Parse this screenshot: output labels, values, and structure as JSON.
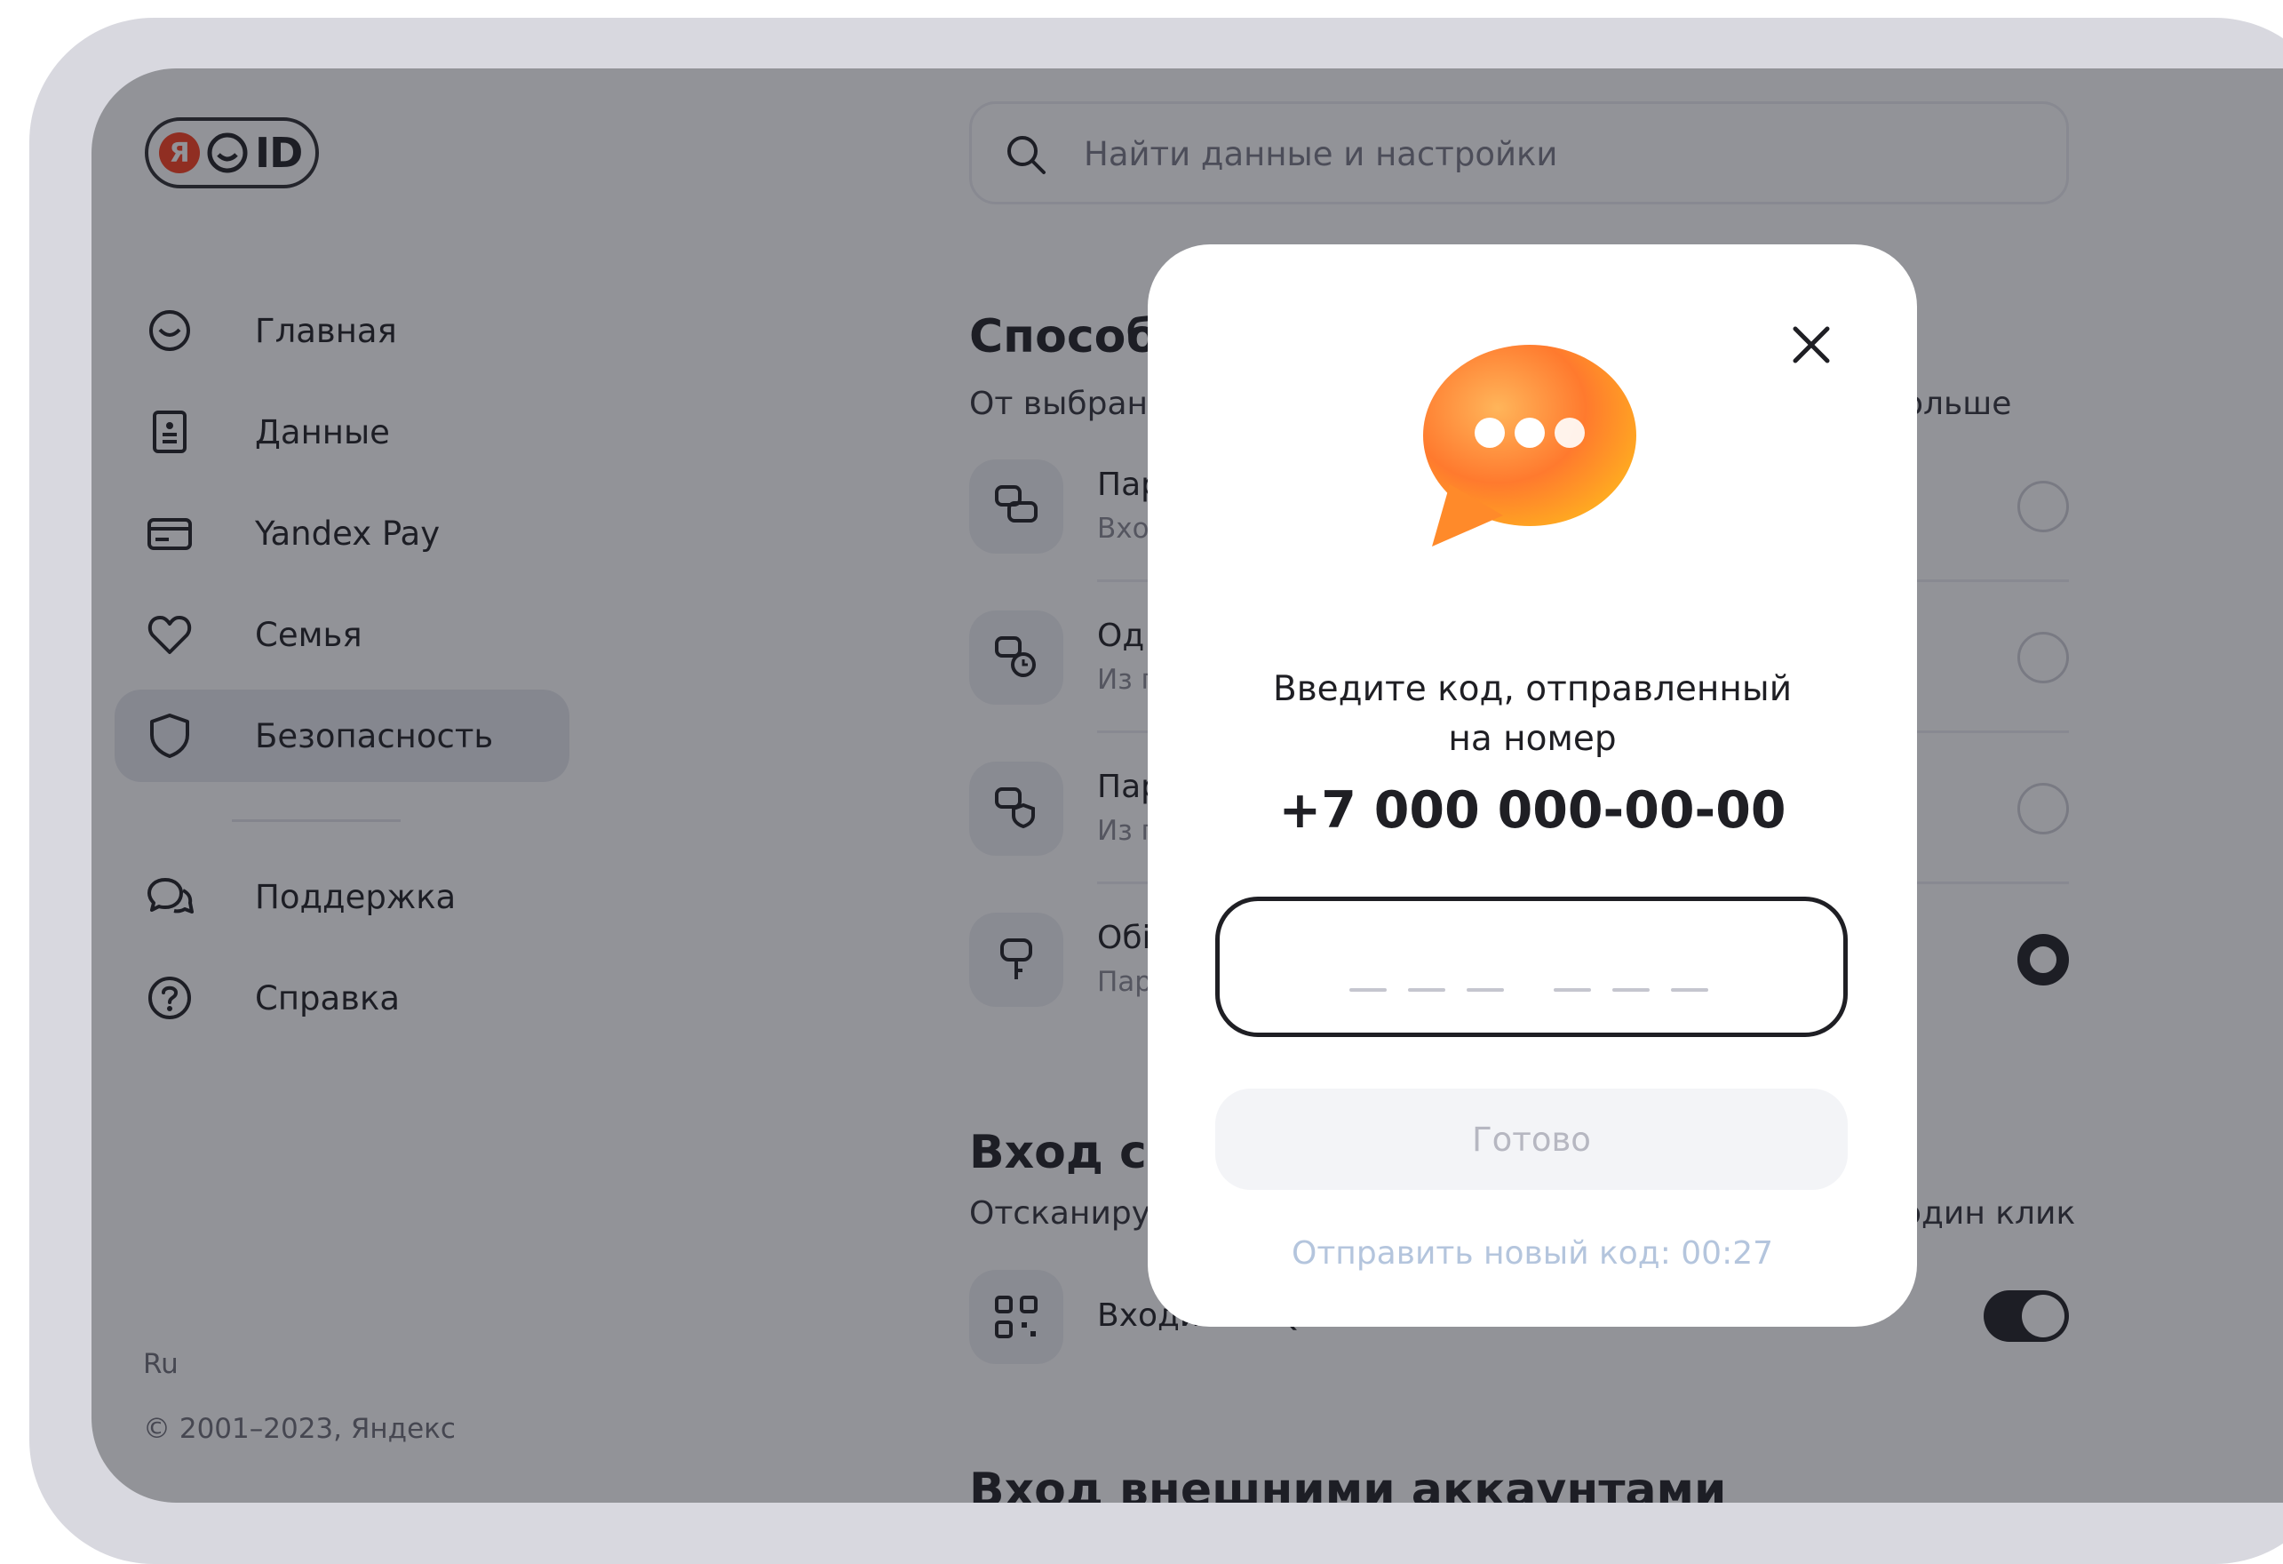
{
  "logo": {
    "ya": "Я",
    "text": "ID"
  },
  "search": {
    "placeholder": "Найти данные и настройки"
  },
  "sidebar": {
    "items": [
      {
        "label": "Главная",
        "icon": "home-smile-icon"
      },
      {
        "label": "Данные",
        "icon": "document-icon"
      },
      {
        "label": "Yandex Pay",
        "icon": "card-icon"
      },
      {
        "label": "Семья",
        "icon": "heart-icon"
      },
      {
        "label": "Безопасность",
        "icon": "shield-icon",
        "active": true
      }
    ],
    "secondary": [
      {
        "label": "Поддержка",
        "icon": "chat-icon"
      },
      {
        "label": "Справка",
        "icon": "help-icon"
      }
    ],
    "lang": "Ru",
    "copyright": "© 2001–2023, Яндекс"
  },
  "main": {
    "methods_section": {
      "title_visible": "Способ",
      "desc_left": "От выбранн",
      "desc_right": "ольше"
    },
    "methods": [
      {
        "title": "Пар",
        "sub": "Вход",
        "selected": false
      },
      {
        "title": "Од",
        "sub": "Из п",
        "selected": false
      },
      {
        "title": "Пар",
        "sub": "Из п",
        "selected": false
      },
      {
        "title": "Обі",
        "sub": "Пар",
        "selected": true
      }
    ],
    "qr_section": {
      "title_visible": "Вход с по",
      "desc_left": "Отсканируі",
      "desc_right": "один клик",
      "row_label": "Входить с QR",
      "toggle_on": true
    },
    "external_section": {
      "title": "Вход внешними аккаунтами"
    }
  },
  "modal": {
    "prompt_line1": "Введите код, отправленный",
    "prompt_line2": "на номер",
    "phone": "+7 000 000-00-00",
    "done_label": "Готово",
    "resend_label": "Отправить новый код: 00:27",
    "accent_color": "#fc3f1d"
  }
}
